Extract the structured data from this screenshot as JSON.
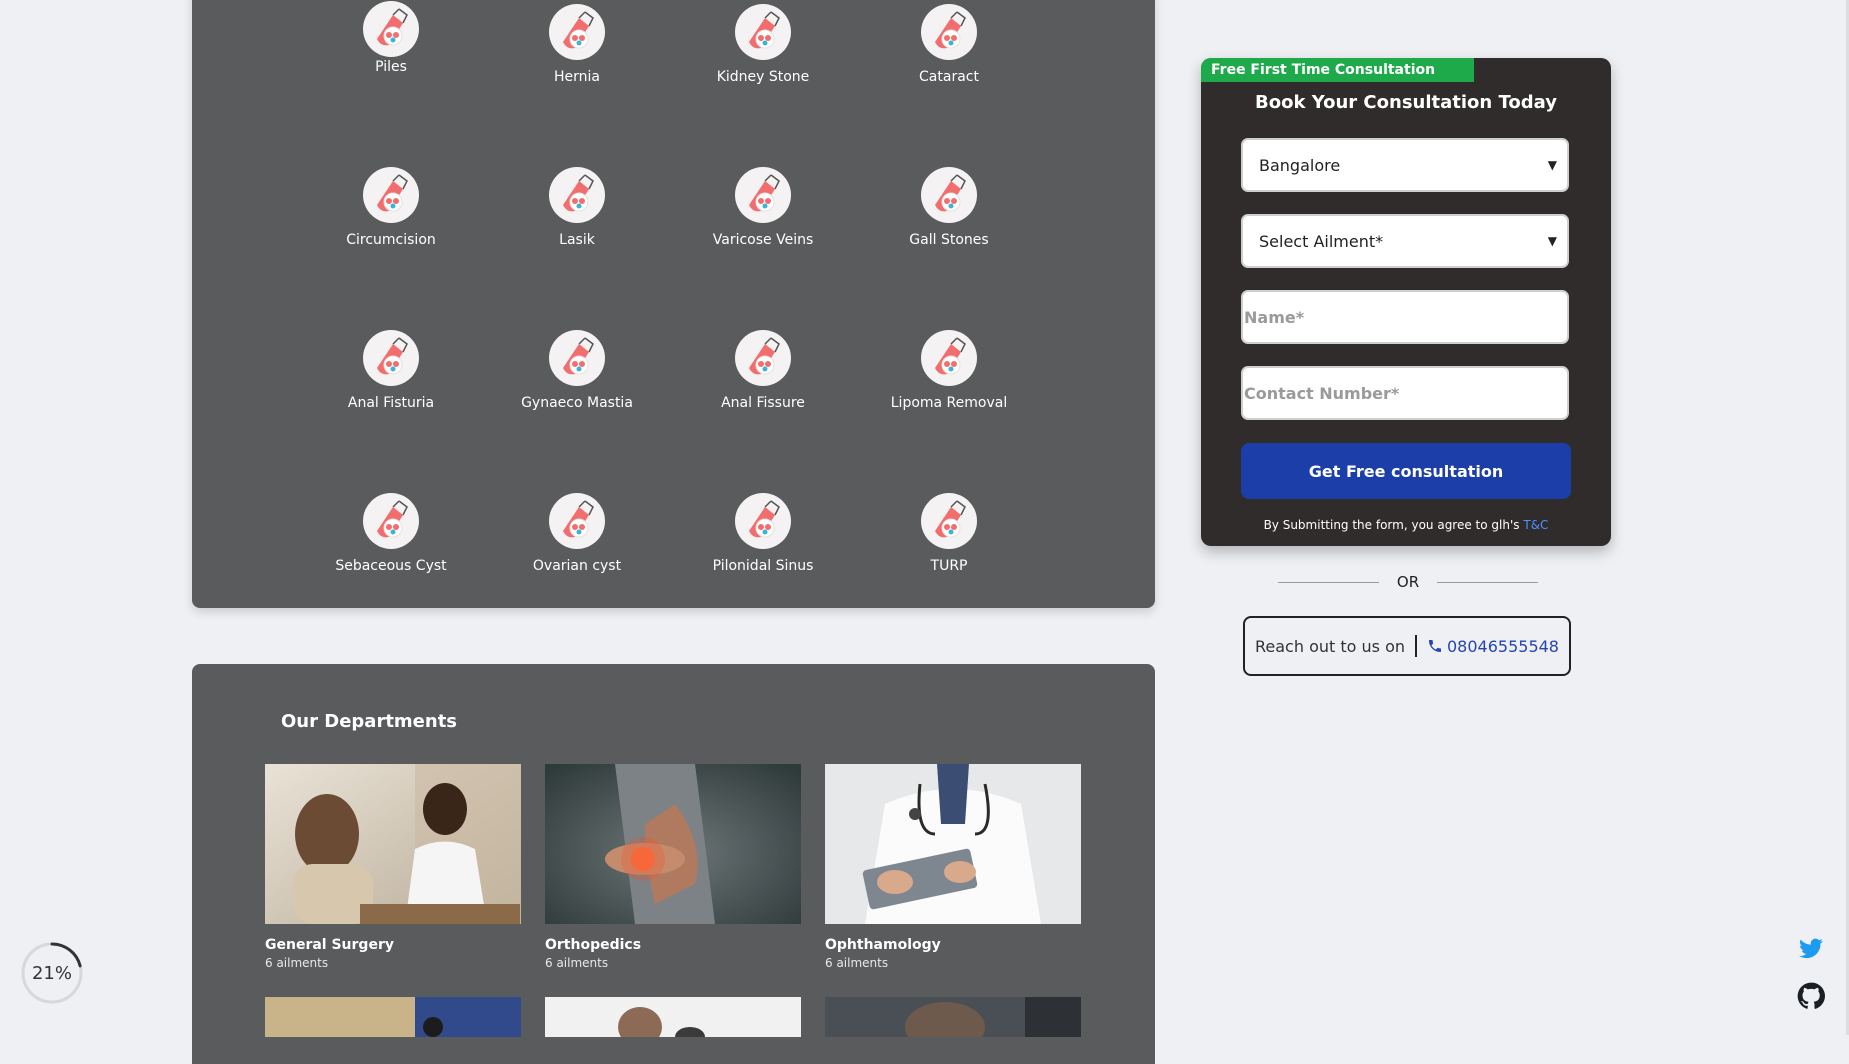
{
  "ailments": [
    {
      "label": "Piles"
    },
    {
      "label": "Hernia"
    },
    {
      "label": "Kidney Stone"
    },
    {
      "label": "Cataract"
    },
    {
      "label": "Circumcision"
    },
    {
      "label": "Lasik"
    },
    {
      "label": "Varicose Veins"
    },
    {
      "label": "Gall Stones"
    },
    {
      "label": "Anal Fisturia"
    },
    {
      "label": "Gynaeco Mastia"
    },
    {
      "label": "Anal Fissure"
    },
    {
      "label": "Lipoma Removal"
    },
    {
      "label": "Sebaceous Cyst"
    },
    {
      "label": "Ovarian cyst"
    },
    {
      "label": "Pilonidal Sinus"
    },
    {
      "label": "TURP"
    }
  ],
  "departments": {
    "title": "Our Departments",
    "items": [
      {
        "name": "General Surgery",
        "count": "6 ailments"
      },
      {
        "name": "Orthopedics",
        "count": "6 ailments"
      },
      {
        "name": "Ophthamology",
        "count": "6 ailments"
      }
    ]
  },
  "booking": {
    "badge": "Free First Time Consultation",
    "title": "Book Your Consultation Today",
    "city_value": "Bangalore",
    "ailment_value": "Select Ailment*",
    "name_placeholder": "Name*",
    "contact_placeholder": "Contact Number*",
    "submit_label": "Get Free consultation",
    "terms_text": "By Submitting the form, you agree to glh's",
    "terms_link": "T&C"
  },
  "or_text": "OR",
  "reach": {
    "label": "Reach out to us on",
    "phone": "08046555548"
  },
  "progress": {
    "text": "21%",
    "value": 0.21
  },
  "icons": {
    "ailment": "test-tube-icon",
    "phone": "phone-icon",
    "social": [
      "twitter-icon",
      "github-icon"
    ]
  },
  "colors": {
    "panel": "#5a5b5d",
    "badge": "#1eaa4b",
    "button": "#1c3ea8",
    "link": "#4e8fff"
  }
}
